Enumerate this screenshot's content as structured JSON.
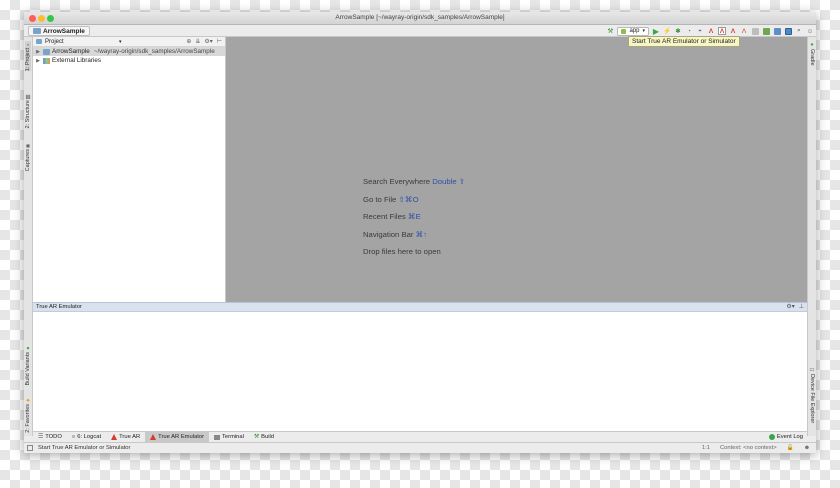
{
  "window": {
    "title": "ArrowSample [~/wayray-origin/sdk_samples/ArrowSample]"
  },
  "navbar": {
    "breadcrumb": "ArrowSample"
  },
  "toolbar": {
    "run_config": "app",
    "tooltip": "Start True AR Emulator or Simulator",
    "icons": [
      "hammer-icon",
      "app-config-icon",
      "run-icon",
      "instant-run-icon",
      "debug-icon",
      "profile-icon",
      "attach-icon",
      "true-ar-icon",
      "true-ar-emulator-icon",
      "true-ar-device-icon",
      "apply-changes-icon",
      "stop-icon",
      "sdk-manager-icon",
      "avd-manager-icon",
      "project-structure-icon",
      "search-icon",
      "user-icon"
    ]
  },
  "left_strip": {
    "project": "1: Project",
    "structure": "2: Structure",
    "captures": "Captures",
    "build_variants": "Build Variants",
    "favorites": "2: Favorites"
  },
  "right_strip": {
    "gradle": "Gradle",
    "device_file_explorer": "Device File Explorer"
  },
  "project_panel": {
    "view_selector": "Project",
    "tree": [
      {
        "name": "ArrowSample",
        "path": "~/wayray-origin/sdk_samples/ArrowSample",
        "selected": true
      },
      {
        "name": "External Libraries",
        "path": "",
        "selected": false
      }
    ]
  },
  "editor": {
    "hints": [
      {
        "text": "Search Everywhere",
        "shortcut": "Double ⇧"
      },
      {
        "text": "Go to File",
        "shortcut": "⇧⌘O"
      },
      {
        "text": "Recent Files",
        "shortcut": "⌘E"
      },
      {
        "text": "Navigation Bar",
        "shortcut": "⌘↑"
      },
      {
        "text": "Drop files here to open",
        "shortcut": ""
      }
    ]
  },
  "emulator_panel": {
    "title": "True AR Emulator"
  },
  "bottom_tabs": {
    "todo": "TODO",
    "logcat": "6: Logcat",
    "true_ar": "True AR",
    "true_ar_emulator": "True AR Emulator",
    "terminal": "Terminal",
    "build": "Build",
    "event_log": "Event Log"
  },
  "statusbar": {
    "message": "Start True AR Emulator or Simulator",
    "position": "1:1",
    "context": "Context: <no context>"
  },
  "colors": {
    "editor_bg": "#a4a4a4",
    "panel_header": "#d8e1ee",
    "shortcut": "#2f4fa8",
    "true_ar_red": "#d53a2c",
    "run_green": "#3aa54a"
  }
}
